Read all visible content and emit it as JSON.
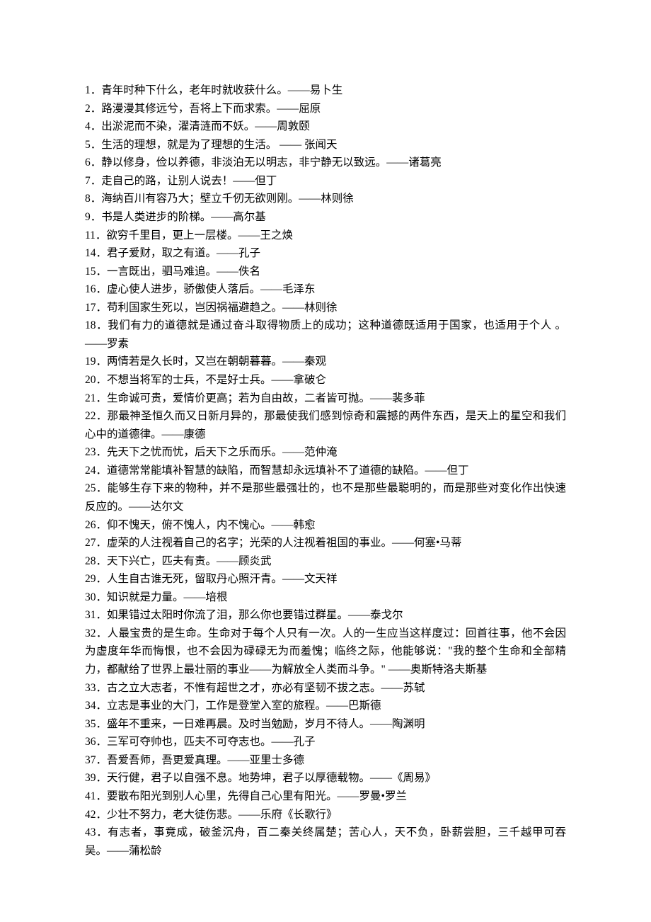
{
  "quotes": [
    {
      "num": "1．",
      "text": "青年时种下什么，老年时就收获什么。——易卜生"
    },
    {
      "num": "2．",
      "text": "路漫漫其修远兮，吾将上下而求索。——屈原"
    },
    {
      "num": "4．",
      "text": "出淤泥而不染，濯清涟而不妖。——周敦颐"
    },
    {
      "num": "5．",
      "text": "生活的理想，就是为了理想的生活。 —— 张闻天"
    },
    {
      "num": "6．",
      "text": "静以修身，俭以养德，非淡泊无以明志，非宁静无以致远。——诸葛亮"
    },
    {
      "num": "7．",
      "text": "走自己的路，让别人说去！——但丁"
    },
    {
      "num": "8．",
      "text": "海纳百川有容乃大；壁立千仞无欲则刚。——林则徐"
    },
    {
      "num": "9．",
      "text": "书是人类进步的阶梯。——高尔基"
    },
    {
      "num": "11．",
      "text": "欲穷千里目，更上一层楼。——王之焕"
    },
    {
      "num": "14．",
      "text": "君子爱财，取之有道。——孔子"
    },
    {
      "num": "15．",
      "text": "一言既出，驷马难追。——佚名"
    },
    {
      "num": "16．",
      "text": "虚心使人进步，骄傲使人落后。——毛泽东"
    },
    {
      "num": "17．",
      "text": "苟利国家生死以，岂因祸福避趋之。——林则徐"
    },
    {
      "num": "18．",
      "text": "我们有力的道德就是通过奋斗取得物质上的成功；这种道德既适用于国家，也适用于个人 。——罗素"
    },
    {
      "num": "19．",
      "text": "两情若是久长时，又岂在朝朝暮暮。——秦观"
    },
    {
      "num": "20．",
      "text": "不想当将军的士兵，不是好士兵。——拿破仑"
    },
    {
      "num": "21．",
      "text": "生命诚可贵，爱情价更高；若为自由故，二者皆可抛。——裴多菲"
    },
    {
      "num": "22．",
      "text": "那最神圣恒久而又日新月异的，那最使我们感到惊奇和震撼的两件东西，是天上的星空和我们心中的道德律。——康德"
    },
    {
      "num": "23．",
      "text": "先天下之忧而忧，后天下之乐而乐。——范仲淹"
    },
    {
      "num": "24．",
      "text": "道德常常能填补智慧的缺陷，而智慧却永远填补不了道德的缺陷。——但丁"
    },
    {
      "num": "25．",
      "text": "能够生存下来的物种，并不是那些最强壮的，也不是那些最聪明的，而是那些对变化作出快速反应的。——达尔文"
    },
    {
      "num": "26．",
      "text": "仰不愧天，俯不愧人，内不愧心。——韩愈"
    },
    {
      "num": "27．",
      "text": "虚荣的人注视着自己的名字；光荣的人注视着祖国的事业。——何塞•马蒂"
    },
    {
      "num": "28．",
      "text": "天下兴亡，匹夫有责。——顾炎武"
    },
    {
      "num": "29．",
      "text": "人生自古谁无死，留取丹心照汗青。——文天祥"
    },
    {
      "num": "30．",
      "text": "知识就是力量。——培根"
    },
    {
      "num": "31．",
      "text": "如果错过太阳时你流了泪，那么你也要错过群星。——泰戈尔"
    },
    {
      "num": "32．",
      "text": "人最宝贵的是生命。生命对于每个人只有一次。人的一生应当这样度过：回首往事，他不会因为虚度年华而悔恨，也不会因为碌碌无为而羞愧；临终之际，他能够说：\"我的整个生命和全部精力，都献给了世界上最壮丽的事业——为解放全人类而斗争。\" ——奥斯特洛夫斯基"
    },
    {
      "num": "33．",
      "text": "古之立大志者，不惟有超世之才，亦必有坚韧不拔之志。——苏轼"
    },
    {
      "num": "34．",
      "text": "立志是事业的大门，工作是登堂入室的旅程。——巴斯德"
    },
    {
      "num": "35．",
      "text": "盛年不重来，一日难再晨。及时当勉励，岁月不待人。——陶渊明"
    },
    {
      "num": "36．",
      "text": "三军可夺帅也，匹夫不可夺志也。——孔子"
    },
    {
      "num": "37．",
      "text": "吾爱吾师，吾更爱真理。——亚里士多德"
    },
    {
      "num": "39．",
      "text": "天行健，君子以自强不息。地势坤，君子以厚德载物。——《周易》"
    },
    {
      "num": "41．",
      "text": "要散布阳光到别人心里，先得自己心里有阳光。——罗曼•罗兰"
    },
    {
      "num": "42．",
      "text": "少壮不努力，老大徒伤悲。——乐府《长歌行》"
    },
    {
      "num": "43．",
      "text": "有志者，事竟成，破釜沉舟，百二秦关终属楚；苦心人，天不负，卧薪尝胆，三千越甲可吞吴。——蒲松龄"
    }
  ]
}
